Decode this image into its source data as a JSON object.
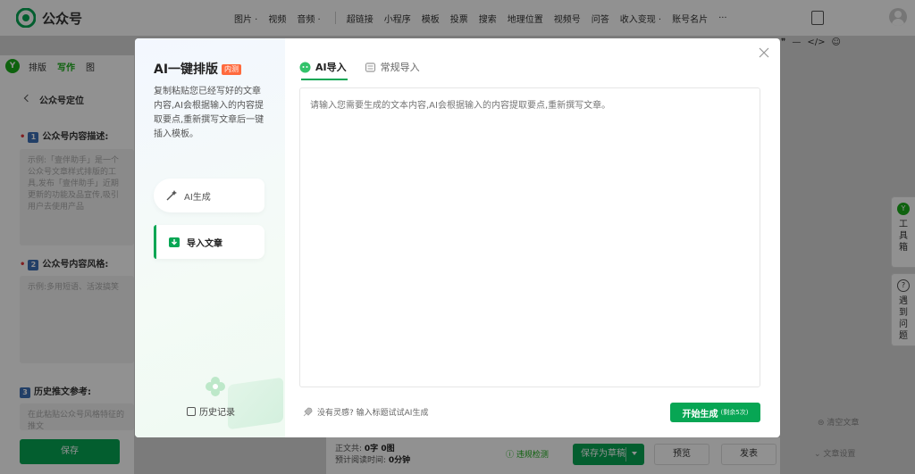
{
  "app": {
    "title": "公众号",
    "menu": [
      "图片",
      "视频",
      "音频",
      "超链接",
      "小程序",
      "模板",
      "投票",
      "搜索",
      "地理位置",
      "视频号",
      "问答",
      "收入变现",
      "账号名片",
      "···"
    ],
    "dropdown_marks": "·"
  },
  "left_panel": {
    "badge": "Y",
    "modes": [
      "排版",
      "写作",
      "图"
    ],
    "back_label": "公众号定位",
    "field1": {
      "num": "1",
      "label": "公众号内容描述:",
      "placeholder": "示例:「壹伴助手」是一个公众号文章样式排版的工具,发布「壹伴助手」近期更新的功能及品宣传,吸引用户去使用产品"
    },
    "field2": {
      "num": "2",
      "label": "公众号内容风格:",
      "placeholder": "示例:多用短语、活泼搞笑"
    },
    "field3": {
      "num": "3",
      "label": "历史推文参考:",
      "placeholder": "在此粘贴公众号风格特征的推文"
    },
    "save_label": "保存"
  },
  "editor": {
    "toolbar_tail": [
      "❞",
      "—",
      "</>",
      "☺"
    ],
    "word_count_label": "正文共:",
    "word_count_value": "0字 0图",
    "read_time_label": "预计阅读时间:",
    "read_time_value": "0分钟",
    "compliance_label": "违规检测",
    "draft_label": "保存为草稿",
    "preview_label": "预览",
    "publish_label": "发表",
    "clear_label": "清空文章",
    "settings_label": "文章设置"
  },
  "side": {
    "toolbox_badge": "Y",
    "toolbox_label": "工具箱",
    "help_badge": "?",
    "help_label": "遇到问题"
  },
  "modal": {
    "title": "AI一键排版",
    "beta": "内测",
    "description": "复制粘贴您已经写好的文章内容,AI会根据输入的内容提取要点,重新撰写文章后一键插入模板。",
    "nav": [
      {
        "label": "AI生成"
      },
      {
        "label": "导入文章"
      }
    ],
    "history_label": "历史记录",
    "tabs": [
      {
        "label": "AI导入"
      },
      {
        "label": "常规导入"
      }
    ],
    "input_placeholder": "请输入您需要生成的文本内容,AI会根据输入的内容提取要点,重新撰写文章。",
    "inspire_text": "没有灵感? 输入标题试试AI生成",
    "generate_label": "开始生成",
    "remaining": "(剩余5次)"
  },
  "colors": {
    "brand_green": "#07a654",
    "beta_orange": "#ff6a3d",
    "overlay": "rgba(0,0,0,0.43)"
  },
  "icons": [
    "logo-icon",
    "magic-wand-icon",
    "import-icon",
    "close-icon",
    "history-icon",
    "rocket-icon",
    "ai-bot-icon",
    "document-icon",
    "avatar-icon",
    "phone-preview-icon"
  ]
}
